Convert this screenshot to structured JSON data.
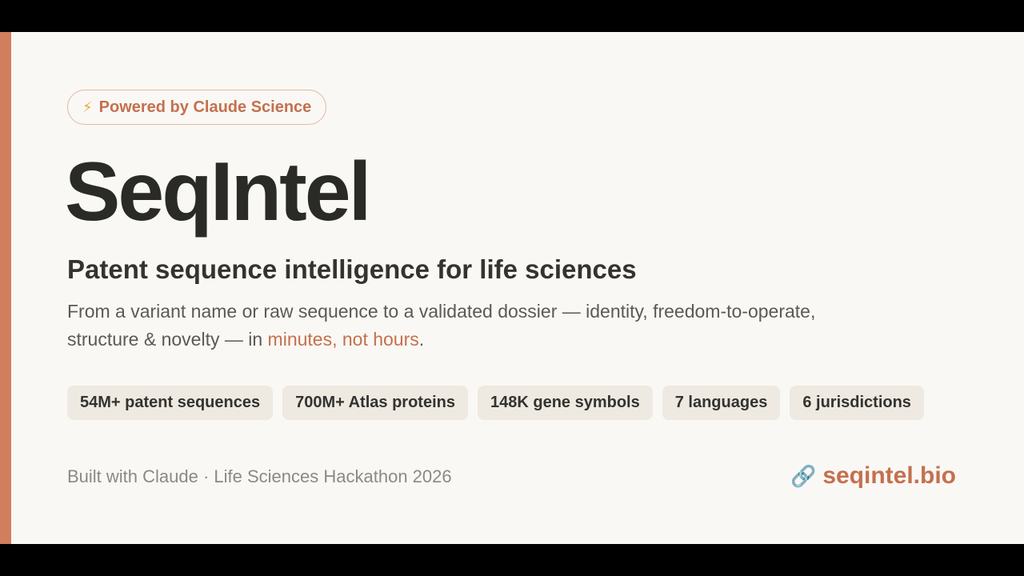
{
  "badge": {
    "icon": "lightning-icon",
    "label": "Powered by Claude Science"
  },
  "title": "SeqIntel",
  "subtitle": "Patent sequence intelligence for life sciences",
  "description": {
    "text_before": "From a variant name or raw sequence to a validated dossier — identity, freedom-to-operate, structure & novelty — in ",
    "highlight": "minutes, not hours",
    "text_after": "."
  },
  "stats": [
    {
      "label": "54M+ patent sequences"
    },
    {
      "label": "700M+ Atlas proteins"
    },
    {
      "label": "148K gene symbols"
    },
    {
      "label": "7 languages"
    },
    {
      "label": "6 jurisdictions"
    }
  ],
  "footer": {
    "credit": "Built with Claude · Life Sciences Hackathon 2026",
    "link_icon": "link-icon",
    "link_label": "seqintel.bio"
  },
  "colors": {
    "accent": "#d07e5e",
    "accent_text": "#c4704f",
    "background": "#faf8f4",
    "chip_background": "#eee9e1"
  }
}
